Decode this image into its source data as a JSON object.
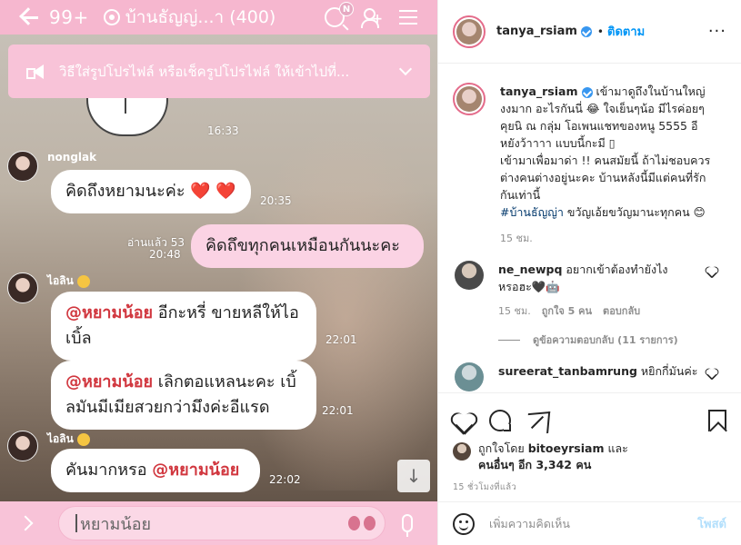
{
  "line_chat": {
    "header": {
      "unread_count": "99+",
      "group_name": "บ้านธัญญ่...า (400)",
      "notification_badge": "N"
    },
    "notice": {
      "text": "วิธีใส่รูปโปรไฟล์ หรือเช็ครูปโปรไฟล์ ให้เข้าไปที่..."
    },
    "messages": [
      {
        "time": "16:33"
      },
      {
        "sender": "nonglak",
        "text": "คิดถึงหยามนะค่ะ",
        "emoji": "❤️ ❤️",
        "time": "20:35"
      },
      {
        "read_label": "อ่านแล้ว 53",
        "time": "20:48",
        "text": "คิดถึขทุกคนเหมือนกันนะคะ"
      },
      {
        "sender": "ไอลิน",
        "mention": "@หยามน้อย",
        "text": " อีกะหรี่ ขายหลีให้ไอ",
        "text2": "เบิ้ล",
        "time": "22:01"
      },
      {
        "mention": "@หยามน้อย",
        "text": " เลิกตอแหลนะคะ เบิ้",
        "text2": "ลมันมีเมียสวยกว่ามึงค่ะอีแรด",
        "time": "22:01"
      },
      {
        "sender": "ไอลิน",
        "text": "คันมากหรอ ",
        "mention": "@หยามน้อย",
        "time": "22:02"
      }
    ],
    "input": {
      "value": "หยามน้อย"
    }
  },
  "instagram": {
    "username": "tanya_rsiam",
    "dot": "•",
    "follow_label": "ติดตาม",
    "more": "···",
    "caption": {
      "username": "tanya_rsiam",
      "line1": " เข้ามาดูถึงในบ้านใหญ่",
      "line2": "งงมาก อะไรกันนี่ 😂 ใจเย็นๆน้อ มีไรค่อยๆ",
      "line3": "คุยนิ ณ กลุ่ม โอเพนแชทของหนู 5555 อี",
      "line4": "หยังว้าาาา แบบนี้กะมี ▯",
      "line5": "เข้ามาเพื่อมาด่า !! คนสมัยนี้ ถ้าไม่ชอบควร",
      "line6": "ต่างคนต่างอยู่นะคะ บ้านหลังนี้มีแต่คนที่รัก",
      "line7": "กันเท่านี้",
      "hashtag": "#บ้านธัญญ่า",
      "line8": " ขวัญเอ้ยขวัญมานะทุกคน 😊",
      "time": "15 ชม."
    },
    "comments": [
      {
        "username": "ne_newpq",
        "text": " อยากเข้าต้องทำยังไง",
        "text2": "หรอฮะ🖤🤖",
        "time": "15 ชม.",
        "likes": "ถูกใจ 5 คน",
        "reply": "ตอบกลับ",
        "view_replies": "ดูข้อความตอบกลับ (11 รายการ)"
      },
      {
        "username": "sureerat_tanbamrung",
        "text": " หยิกกี่มันค่ะ"
      }
    ],
    "liked_by": {
      "prefix": "ถูกใจโดย ",
      "user": "bitoeyrsiam",
      "suffix": " และ",
      "others": "คนอื่นๆ อีก 3,342 คน"
    },
    "ago": "15 ชั่วโมงที่แล้ว",
    "comment_placeholder": "เพิ่มความคิดเห็น",
    "post_label": "โพสต์"
  }
}
